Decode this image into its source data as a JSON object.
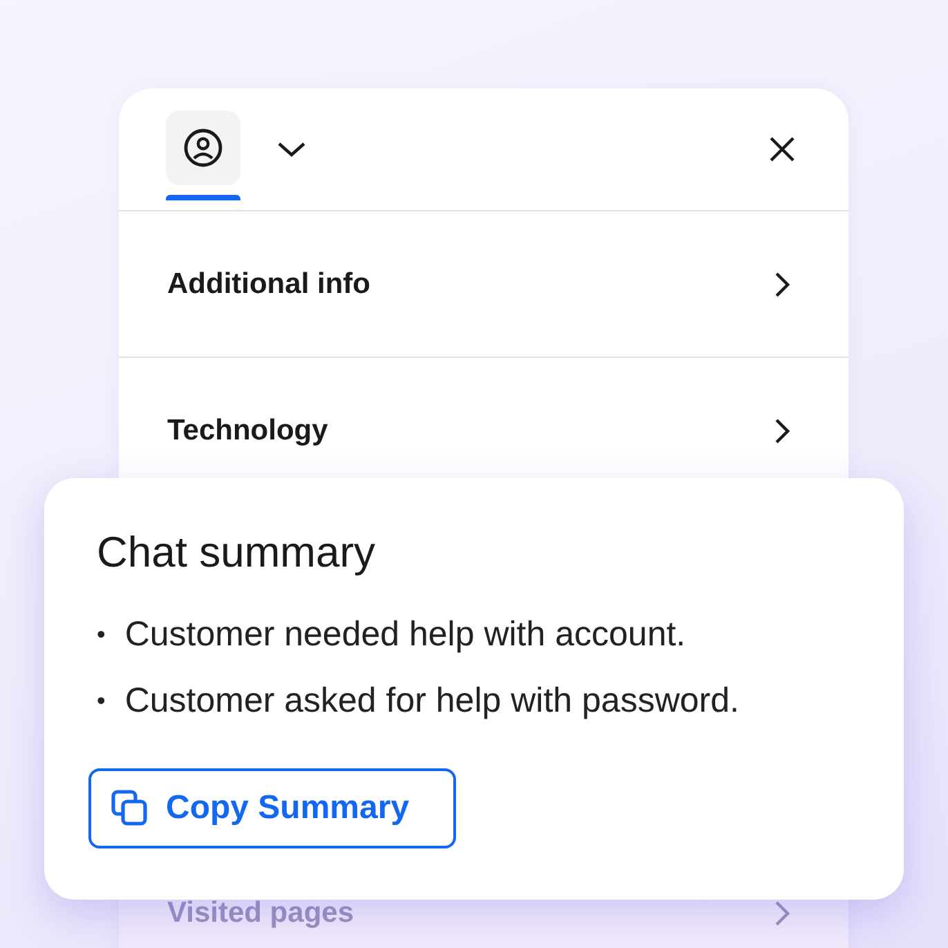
{
  "panel": {
    "tabs": [
      {
        "kind": "profile",
        "selected": true
      }
    ],
    "rows": [
      {
        "label": "Additional info",
        "dimmed": false
      },
      {
        "label": "Technology",
        "dimmed": false
      },
      {
        "label": "Visited pages",
        "dimmed": true
      }
    ]
  },
  "summary_card": {
    "title": "Chat summary",
    "bullets": [
      {
        "marker": "•",
        "text": "Customer needed help with account."
      },
      {
        "marker": "•",
        "text": "Customer asked for help with password."
      }
    ],
    "button": "Copy Summary"
  }
}
